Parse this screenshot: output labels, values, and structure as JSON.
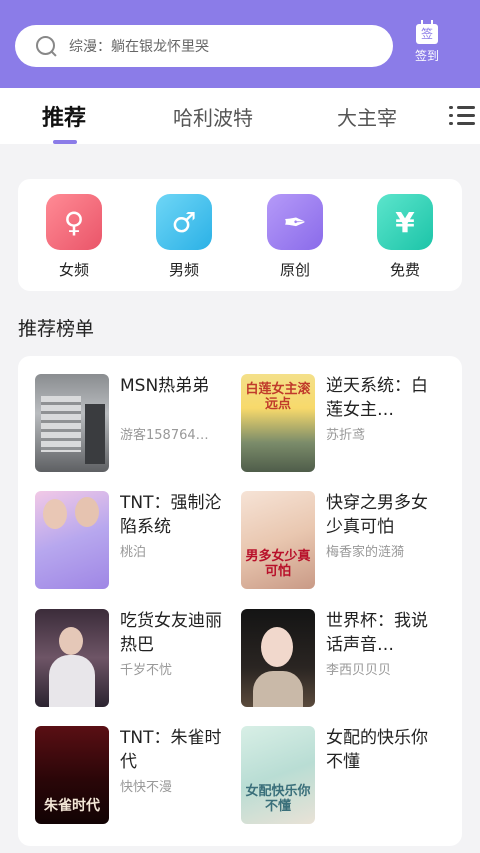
{
  "search": {
    "placeholder": "综漫：躺在银龙怀里哭"
  },
  "signin": {
    "icon_char": "签",
    "label": "签到"
  },
  "tabs": [
    {
      "label": "推荐",
      "active": true
    },
    {
      "label": "哈利波特",
      "active": false
    },
    {
      "label": "大主宰",
      "active": false
    }
  ],
  "categories": [
    {
      "label": "女频",
      "icon": "female-icon",
      "glyph": "♀",
      "color": "#f16b7c"
    },
    {
      "label": "男频",
      "icon": "male-icon",
      "glyph": "♂",
      "color": "#3ec1ea"
    },
    {
      "label": "原创",
      "icon": "pen-icon",
      "glyph": "✒",
      "color": "#9a7ef0"
    },
    {
      "label": "免费",
      "icon": "yen-icon",
      "glyph": "¥",
      "color": "#2fd3b8"
    }
  ],
  "section": {
    "title": "推荐榜单"
  },
  "books": [
    {
      "title": "MSN热弟弟",
      "author": "游客158764…",
      "cover_text": ""
    },
    {
      "title": "逆天系统：白莲女主…",
      "author": "苏折鸢",
      "cover_text": "白莲女主滚远点"
    },
    {
      "title": "TNT：强制沦陷系统",
      "author": "桃泊",
      "cover_text": ""
    },
    {
      "title": "快穿之男多女少真可怕",
      "author": "梅香家的涟漪",
      "cover_text": "男多女少真可怕"
    },
    {
      "title": "吃货女友迪丽热巴",
      "author": "千岁不忧",
      "cover_text": ""
    },
    {
      "title": "世界杯：我说话声音…",
      "author": "李西贝贝贝",
      "cover_text": ""
    },
    {
      "title": "TNT：朱雀时代",
      "author": "快快不漫",
      "cover_text": "朱雀时代"
    },
    {
      "title": "女配的快乐你不懂",
      "author": "",
      "cover_text": "女配快乐你不懂"
    }
  ]
}
